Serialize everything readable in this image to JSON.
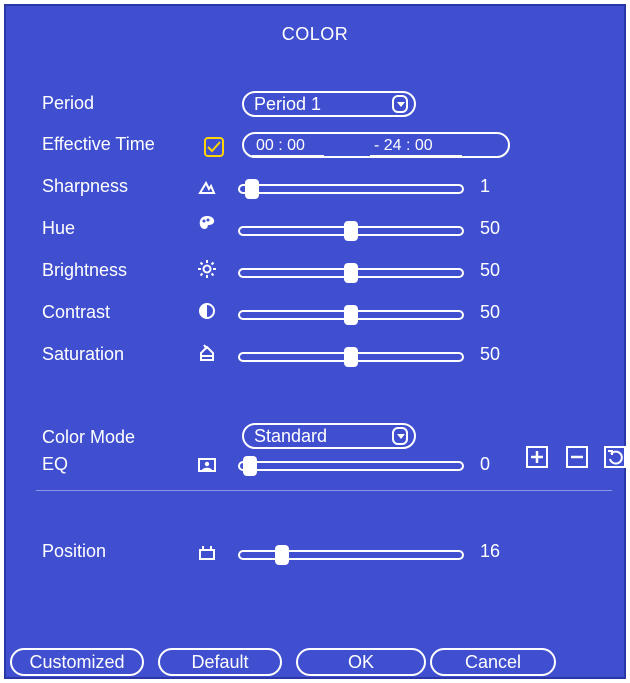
{
  "window": {
    "title": "COLOR"
  },
  "period": {
    "label": "Period",
    "value": "Period 1"
  },
  "effective_time": {
    "label": "Effective Time",
    "checked": true,
    "start": "00 : 00",
    "end": "- 24 : 00"
  },
  "settings": {
    "sharpness": {
      "label": "Sharpness",
      "value": "1",
      "level": 1,
      "icon": "sharpness-icon"
    },
    "hue": {
      "label": "Hue",
      "value": "50",
      "level": 50,
      "icon": "hue-palette-icon"
    },
    "brightness": {
      "label": "Brightness",
      "value": "50",
      "level": 50,
      "icon": "brightness-sun-icon"
    },
    "contrast": {
      "label": "Contrast",
      "value": "50",
      "level": 50,
      "icon": "contrast-icon"
    },
    "saturation": {
      "label": "Saturation",
      "value": "50",
      "level": 50,
      "icon": "saturation-icon"
    }
  },
  "color_mode": {
    "label": "Color Mode",
    "value": "Standard"
  },
  "eq": {
    "label": "EQ",
    "value": "0",
    "level": 0,
    "icon": "eq-icon"
  },
  "position": {
    "label": "Position",
    "value": "16",
    "level": 16,
    "icon": "position-icon"
  },
  "footer": {
    "customized": "Customized",
    "default": "Default",
    "ok": "OK",
    "cancel": "Cancel"
  },
  "colors": {
    "background": "#3f4fcf",
    "text": "#ffffff",
    "checkbox": "#ffd400"
  }
}
